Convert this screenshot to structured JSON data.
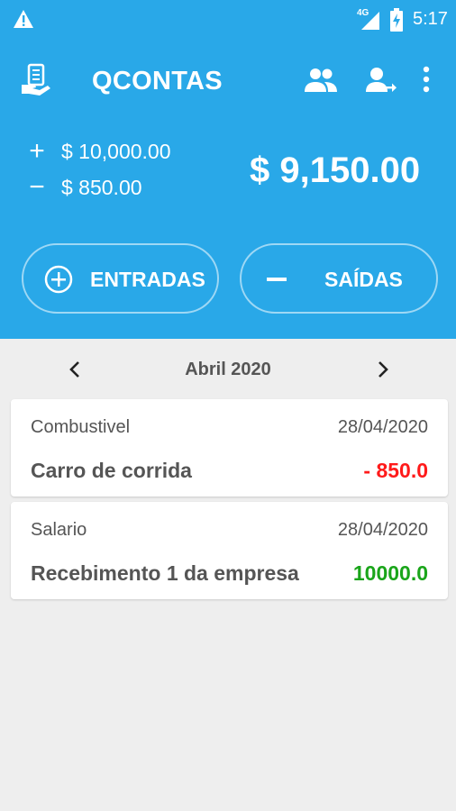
{
  "status_bar": {
    "network_label": "4G",
    "time": "5:17"
  },
  "toolbar": {
    "title": "QCONTAS",
    "logo_icon": "money-hand-icon",
    "actions": [
      "group-icon",
      "person-transfer-icon",
      "more-vert-icon"
    ]
  },
  "summary": {
    "income_sign": "+",
    "income": "$ 10,000.00",
    "expense_sign": "−",
    "expense": "$ 850.00",
    "balance": "$ 9,150.00"
  },
  "buttons": {
    "income_label": "ENTRADAS",
    "expense_label": "SAÍDAS"
  },
  "month_nav": {
    "label": "Abril 2020"
  },
  "transactions": [
    {
      "category": "Combustivel",
      "date": "28/04/2020",
      "description": "Carro de corrida",
      "amount": "- 850.0",
      "type": "expense"
    },
    {
      "category": "Salario",
      "date": "28/04/2020",
      "description": "Recebimento 1 da empresa",
      "amount": "10000.0",
      "type": "income"
    }
  ],
  "colors": {
    "primary": "#29a8e8",
    "expense": "#ff1a1a",
    "income": "#1aa51a",
    "background": "#eeeeee"
  }
}
